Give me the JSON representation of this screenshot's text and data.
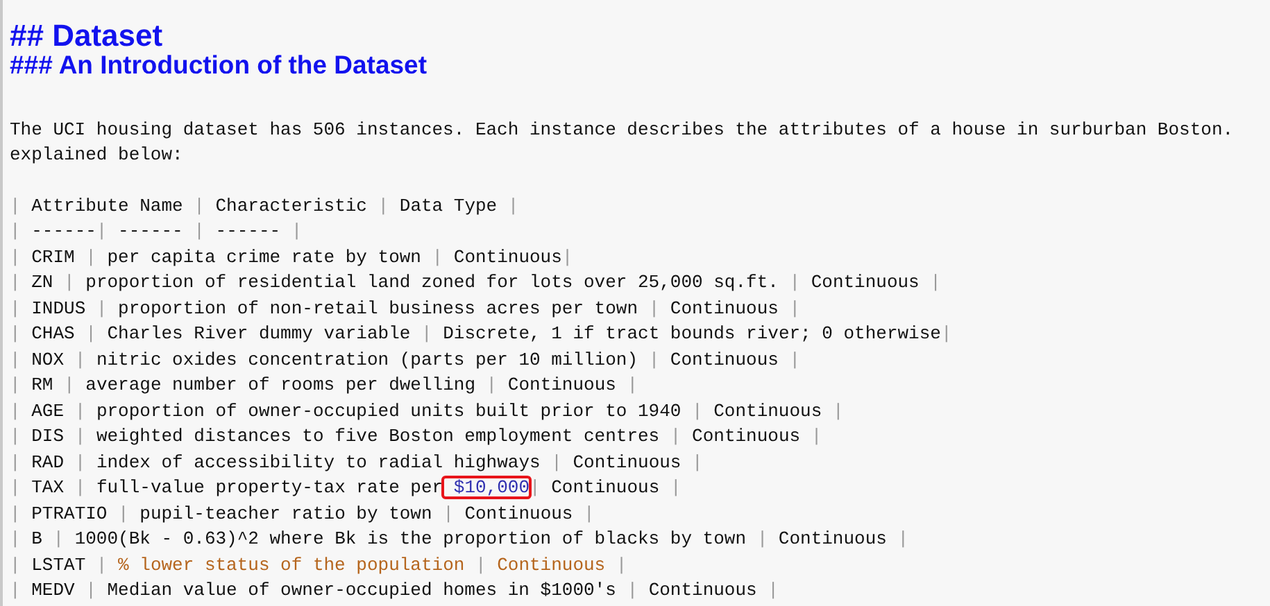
{
  "headings": [
    {
      "text": "## Dataset",
      "kind": "title"
    },
    {
      "text": "### An Introduction of the Dataset",
      "kind": "subtitle"
    }
  ],
  "paragraph": [
    "The UCI housing dataset has 506 instances. Each instance describes the attributes of a house in surburban Boston.",
    "explained below:"
  ],
  "table_lines": [
    [
      "|",
      " Attribute Name ",
      "|",
      " Characteristic ",
      "|",
      " Data Type ",
      "|"
    ],
    [
      "|",
      " ------",
      "|",
      " ------ ",
      "|",
      " ------ ",
      "|"
    ],
    [
      "|",
      " CRIM ",
      "|",
      " per capita crime rate by town ",
      "|",
      " Continuous",
      "|"
    ],
    [
      "|",
      " ZN ",
      "|",
      " proportion of residential land zoned for lots over 25,000 sq.ft. ",
      "|",
      " Continuous ",
      "|"
    ],
    [
      "|",
      " INDUS ",
      "|",
      " proportion of non-retail business acres per town ",
      "|",
      " Continuous ",
      "|"
    ],
    [
      "|",
      " CHAS ",
      "|",
      " Charles River dummy variable ",
      "|",
      " Discrete, 1 if tract bounds river; 0 otherwise",
      "|"
    ],
    [
      "|",
      " NOX ",
      "|",
      " nitric oxides concentration (parts per 10 million) ",
      "|",
      " Continuous ",
      "|"
    ],
    [
      "|",
      " RM ",
      "|",
      " average number of rooms per dwelling ",
      "|",
      " Continuous ",
      "|"
    ],
    [
      "|",
      " AGE ",
      "|",
      " proportion of owner-occupied units built prior to 1940 ",
      "|",
      " Continuous ",
      "|"
    ],
    [
      "|",
      " DIS ",
      "|",
      " weighted distances to five Boston employment centres ",
      "|",
      " Continuous ",
      "|"
    ],
    [
      "|",
      " RAD ",
      "|",
      " index of accessibility to radial highways ",
      "|",
      " Continuous ",
      "|"
    ],
    [
      "|",
      " TAX ",
      "|",
      " full-value property-tax rate per",
      {
        "text": " $10,000",
        "kind": "marked"
      },
      "|",
      " Continuous ",
      "|"
    ],
    [
      "|",
      " PTRATIO ",
      "|",
      " pupil-teacher ratio by town ",
      "|",
      " Continuous ",
      "|"
    ],
    [
      "|",
      " B ",
      "|",
      " 1000(Bk - 0.63)^2 where Bk is the proportion of blacks by town ",
      "|",
      " Continuous ",
      "|"
    ],
    [
      "|",
      " LSTAT ",
      "|",
      {
        "text": " % lower status of the population ",
        "kind": "accent"
      },
      {
        "text": "|",
        "kind": "pipe"
      },
      {
        "text": " Continuous ",
        "kind": "accent"
      },
      {
        "text": "|",
        "kind": "pipe"
      }
    ],
    [
      "|",
      " MEDV ",
      "|",
      " Median value of owner-occupied homes in $1000's ",
      "|",
      " Continuous ",
      "|"
    ]
  ]
}
